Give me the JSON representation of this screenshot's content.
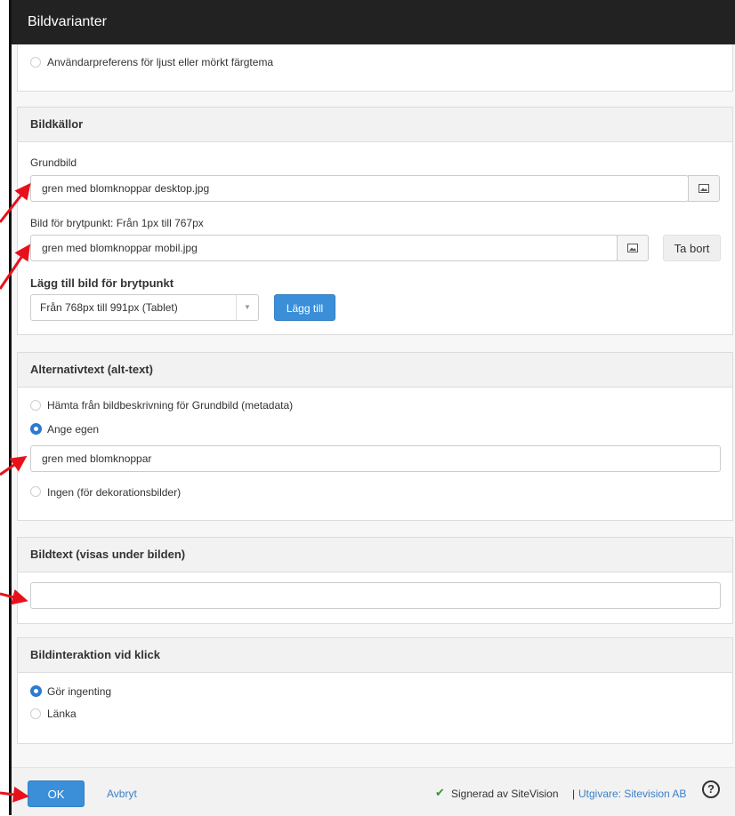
{
  "window": {
    "title": "Bildvarianter"
  },
  "theme_section": {
    "radio_label": "Användarpreferens för ljust eller mörkt färgtema"
  },
  "sources": {
    "heading": "Bildkällor",
    "base_label": "Grundbild",
    "base_value": "gren med blomknoppar desktop.jpg",
    "breakpoint_label": "Bild för brytpunkt: Från 1px till 767px",
    "breakpoint_value": "gren med blomknoppar mobil.jpg",
    "remove_label": "Ta bort",
    "add_heading": "Lägg till bild för brytpunkt",
    "select_value": "Från 768px till 991px (Tablet)",
    "add_button": "Lägg till"
  },
  "alt": {
    "heading": "Alternativtext (alt-text)",
    "option_metadata": "Hämta från bildbeskrivning för Grundbild (metadata)",
    "option_custom": "Ange egen",
    "custom_value": "gren med blomknoppar",
    "option_none": "Ingen (för dekorationsbilder)"
  },
  "caption": {
    "heading": "Bildtext (visas under bilden)",
    "value": ""
  },
  "interaction": {
    "heading": "Bildinteraktion vid klick",
    "option_nothing": "Gör ingenting",
    "option_link": "Länka"
  },
  "footer": {
    "ok": "OK",
    "cancel": "Avbryt",
    "signed": "Signerad av SiteVision",
    "separator": "|",
    "publisher": "Utgivare: Sitevision AB",
    "help_symbol": "?"
  },
  "colors": {
    "accent": "#3a8fd8",
    "titlebar": "#222222",
    "annotation": "#e8111b",
    "check": "#2a9b2a"
  },
  "icons": [
    "image-icon",
    "chevron-down-icon",
    "checkmark-icon",
    "help-icon",
    "annotation-arrow"
  ]
}
